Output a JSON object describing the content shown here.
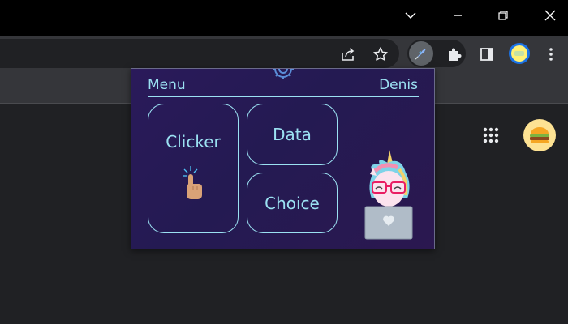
{
  "window_controls": {
    "dropdown_icon": "chevron-down-icon",
    "minimize_icon": "minimize-icon",
    "restore_icon": "restore-icon",
    "close_icon": "close-icon"
  },
  "toolbar": {
    "share_icon": "share-icon",
    "bookmark_icon": "star-icon",
    "extension_icon": "rocket-extension-icon",
    "extensions_icon": "puzzle-icon",
    "side_panel_icon": "side-panel-icon",
    "profile_icon": "profile-avatar-icon",
    "menu_icon": "more-vert-icon"
  },
  "page": {
    "apps_icon": "apps-grid-icon",
    "account_icon": "burger-avatar-icon"
  },
  "popup": {
    "menu_label": "Menu",
    "user_name": "Denis",
    "settings_icon": "gear-icon",
    "tiles": {
      "clicker": "Clicker",
      "data": "Data",
      "choice": "Choice"
    },
    "clicker_icon": "pointing-finger-icon",
    "mascot": "unicorn-laptop-illustration"
  },
  "colors": {
    "accent": "#9be1f2",
    "popup_bg": "#2a1a5a",
    "chrome_dark": "#35363a"
  }
}
